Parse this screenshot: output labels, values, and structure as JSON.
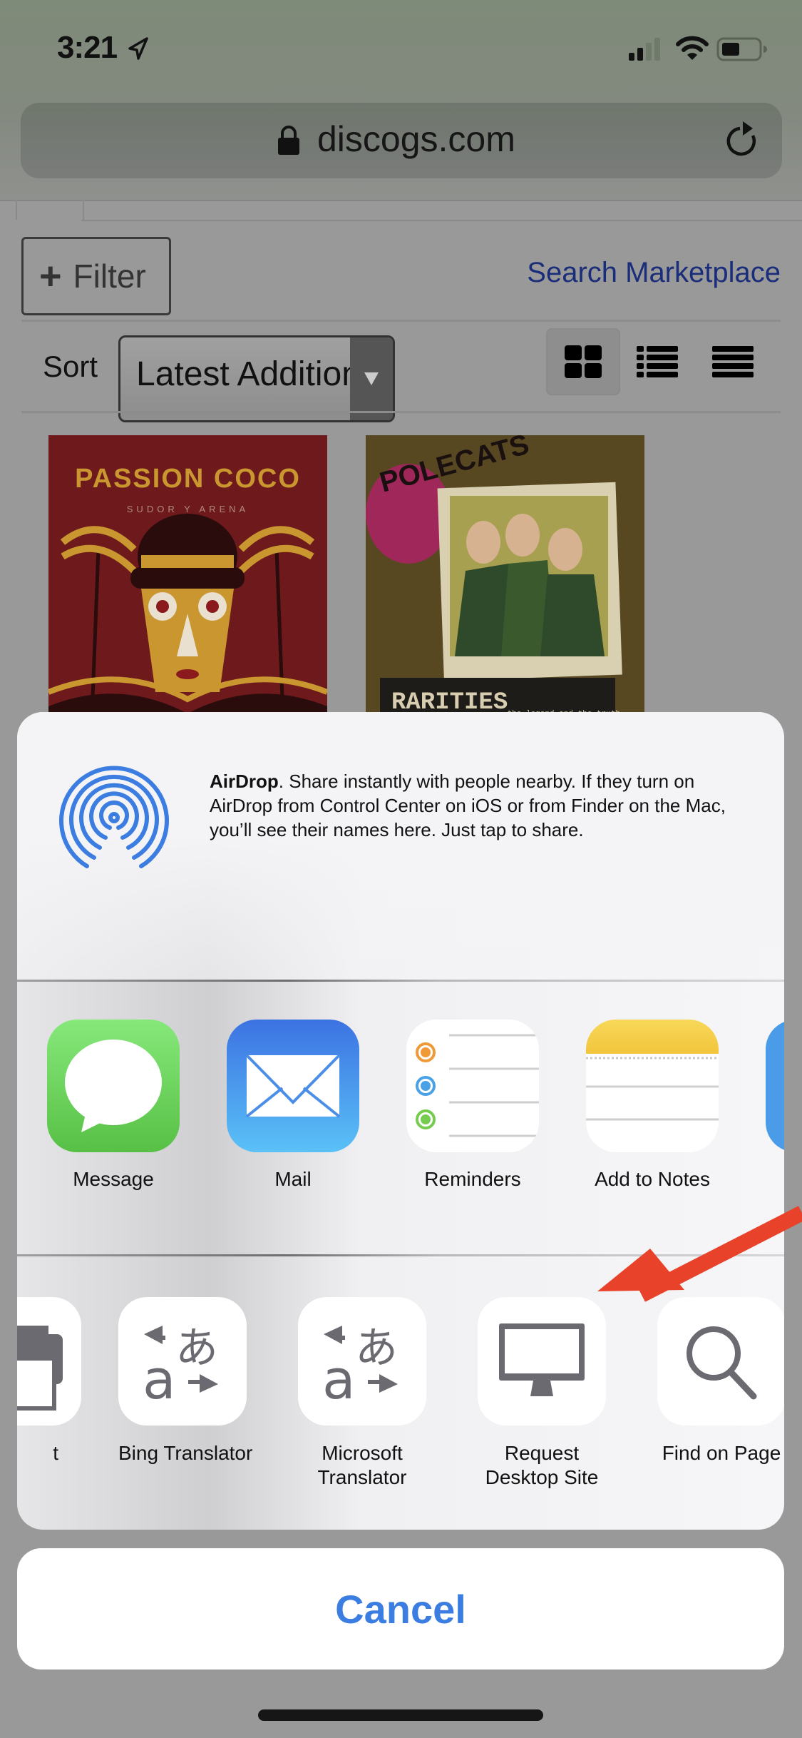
{
  "status_bar": {
    "time": "3:21",
    "icons": [
      "location-arrow-icon",
      "cellular-signal-icon",
      "wifi-icon",
      "battery-icon"
    ],
    "signal_bars_active": 2,
    "signal_bars_total": 4,
    "battery_level": 0.4
  },
  "browser": {
    "url": "discogs.com",
    "secure_icon": "lock-icon",
    "reload_icon": "reload-icon"
  },
  "page": {
    "filter_button": {
      "icon": "plus-icon",
      "label": "Filter"
    },
    "search_marketplace_link": "Search Marketplace",
    "sort": {
      "label": "Sort",
      "selected": "Latest Additions"
    },
    "view_modes": [
      {
        "name": "grid",
        "icon": "grid-view-icon",
        "active": true
      },
      {
        "name": "list",
        "icon": "list-view-icon",
        "active": false
      },
      {
        "name": "rows",
        "icon": "rows-view-icon",
        "active": false
      }
    ],
    "covers": [
      {
        "title": "PASSION COCO",
        "subtitle": "SUDOR Y ARENA"
      },
      {
        "title": "RARITIES",
        "subtitle": "the legend and the truth",
        "band": "POLECATS"
      }
    ]
  },
  "share_sheet": {
    "airdrop": {
      "title": "AirDrop",
      "text": ". Share instantly with people nearby. If they turn on AirDrop from Control Center on iOS or from Finder on the Mac, you’ll see their names here. Just tap to share."
    },
    "apps": [
      {
        "label": "Message",
        "icon": "messages-app-icon",
        "color": "#5fc94f"
      },
      {
        "label": "Mail",
        "icon": "mail-app-icon",
        "color": "#3d86ea"
      },
      {
        "label": "Reminders",
        "icon": "reminders-app-icon",
        "color": "#ffffff"
      },
      {
        "label": "Add to Notes",
        "icon": "notes-app-icon",
        "color": "#f7d04a"
      },
      {
        "label": "",
        "icon": "partial-app-icon",
        "color": "#4a9be8"
      }
    ],
    "actions": [
      {
        "label": "t",
        "full_label": "Print",
        "icon": "print-icon"
      },
      {
        "label": "Bing Translator",
        "icon": "translate-icon"
      },
      {
        "label": "Microsoft\nTranslator",
        "icon": "translate-icon"
      },
      {
        "label": "Request\nDesktop Site",
        "icon": "desktop-icon"
      },
      {
        "label": "Find on Page",
        "icon": "search-icon"
      }
    ],
    "cancel_label": "Cancel"
  },
  "colors": {
    "accent_blue": "#3b7de0",
    "annotation_red": "#e8432a",
    "link_blue": "#1a2d7a"
  }
}
